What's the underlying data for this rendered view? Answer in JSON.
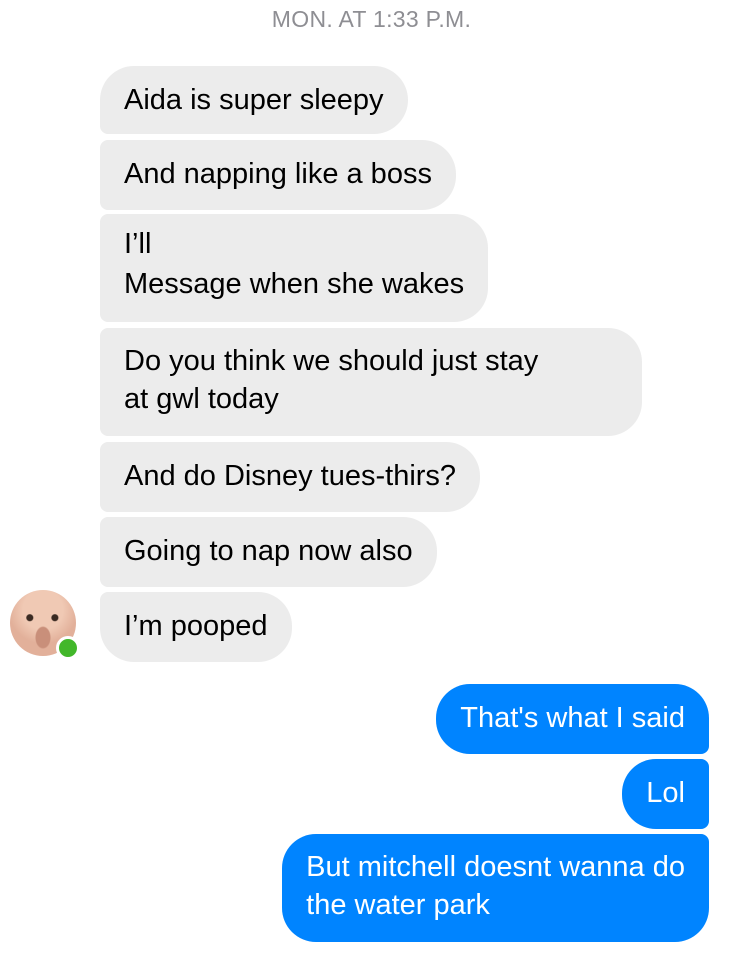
{
  "timestamp": "MON. AT 1:33 P.M.",
  "incoming": [
    {
      "line1": "Aida is super sleepy",
      "line2": ""
    },
    {
      "line1": "And napping like a boss",
      "line2": ""
    },
    {
      "line1": "I’ll",
      "line2": "Message when she wakes"
    },
    {
      "line1": "Do you think we should just stay",
      "line2": "at gwl today"
    },
    {
      "line1": "And do Disney tues-thirs?",
      "line2": ""
    },
    {
      "line1": "Going to nap now also",
      "line2": ""
    },
    {
      "line1": "I’m pooped",
      "line2": ""
    }
  ],
  "outgoing": [
    {
      "line1": "That's what I said",
      "line2": ""
    },
    {
      "line1": "Lol",
      "line2": ""
    },
    {
      "line1": "But mitchell doesnt wanna do",
      "line2": "the water park"
    }
  ],
  "colors": {
    "incoming_bubble": "#ececec",
    "outgoing_bubble": "#0084ff",
    "presence_dot": "#42b72a"
  },
  "icons": {
    "avatar": "contact-photo",
    "presence": "online-dot-icon"
  }
}
